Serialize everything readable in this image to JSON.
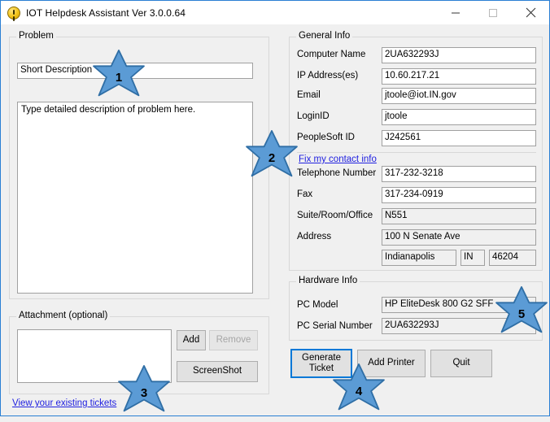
{
  "window": {
    "title": "IOT Helpdesk Assistant Ver 3.0.0.64",
    "icon": "app-warning-icon",
    "minimize_label": "Minimize",
    "maximize_label": "Maximize",
    "close_label": "Close",
    "accent_color": "#2a7fd4",
    "background_color": "#f0f0f0"
  },
  "problem": {
    "group_label": "Problem",
    "short_description": {
      "label": "Short Description",
      "value": "Short Description"
    },
    "detail": {
      "value": "Type detailed description of problem here."
    }
  },
  "attachment": {
    "group_label": "Attachment (optional)",
    "list_value": "",
    "add_label": "Add",
    "remove_label": "Remove",
    "remove_enabled": false,
    "screenshot_label": "ScreenShot",
    "tickets_link": "View your existing tickets"
  },
  "general_info": {
    "group_label": "General Info",
    "fields": [
      {
        "label": "Computer Name",
        "value": "2UA632293J"
      },
      {
        "label": "IP Address(es)",
        "value": "10.60.217.21"
      },
      {
        "label": "Email",
        "value": "jtoole@iot.IN.gov"
      },
      {
        "label": "LoginID",
        "value": "jtoole"
      },
      {
        "label": "PeopleSoft ID",
        "value": "J242561"
      }
    ],
    "fix_contact_link": "Fix my contact info",
    "contact_fields": [
      {
        "label": "Telephone Number",
        "value": "317-232-3218"
      },
      {
        "label": "Fax",
        "value": "317-234-0919"
      },
      {
        "label": "Suite/Room/Office",
        "value": "N551"
      },
      {
        "label": "Address",
        "value": "100 N Senate Ave"
      }
    ],
    "city": "Indianapolis",
    "state": "IN",
    "zip": "46204"
  },
  "hardware_info": {
    "group_label": "Hardware Info",
    "fields": [
      {
        "label": "PC Model",
        "value": "HP EliteDesk 800 G2 SFF"
      },
      {
        "label": "PC Serial Number",
        "value": "2UA632293J"
      }
    ]
  },
  "actions": {
    "generate_ticket_label": "Generate\nTicket",
    "generate_ticket_line1": "Generate",
    "generate_ticket_line2": "Ticket",
    "add_printer_label": "Add Printer",
    "quit_label": "Quit"
  },
  "annotations": {
    "fill_color": "#5b9bd5",
    "stroke_color": "#2f6ea5",
    "badges": [
      {
        "number": "1",
        "target": "short-description-input"
      },
      {
        "number": "2",
        "target": "fix-my-contact-info-link"
      },
      {
        "number": "3",
        "target": "view-existing-tickets-link"
      },
      {
        "number": "4",
        "target": "generate-ticket-button"
      },
      {
        "number": "5",
        "target": "pc-serial-number-field"
      }
    ]
  }
}
